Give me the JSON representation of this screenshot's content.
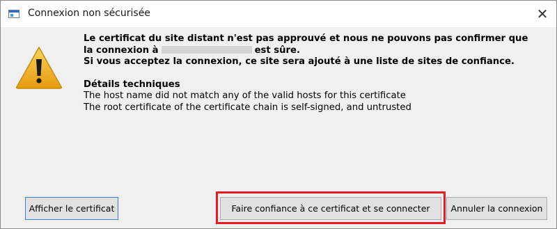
{
  "window": {
    "title": "Connexion non sécurisée",
    "close_symbol": "✕"
  },
  "icons": {
    "app": "application-window-icon",
    "warning": "warning-triangle-icon",
    "close": "close-icon"
  },
  "message": {
    "line1": "Le certificat du site distant n'est pas approuvé et nous ne pouvons pas confirmer que",
    "line2_prefix": "la connexion à",
    "line2_suffix": "est sûre.",
    "line3": "Si vous acceptez la connexion, ce site sera ajouté à une liste de sites de confiance.",
    "details_title": "Détails techniques",
    "detail1": "The host name did not match any of the valid hosts for this certificate",
    "detail2": "The root certificate of the certificate chain is self-signed, and untrusted"
  },
  "buttons": {
    "show_certificate": "Afficher le certificat",
    "trust_and_connect": "Faire confiance à ce certificat et se connecter",
    "cancel": "Annuler la connexion"
  },
  "colors": {
    "highlight": "#e81a24",
    "warning_fill": "#f2b21c",
    "focus_border": "#3b7fd4"
  }
}
